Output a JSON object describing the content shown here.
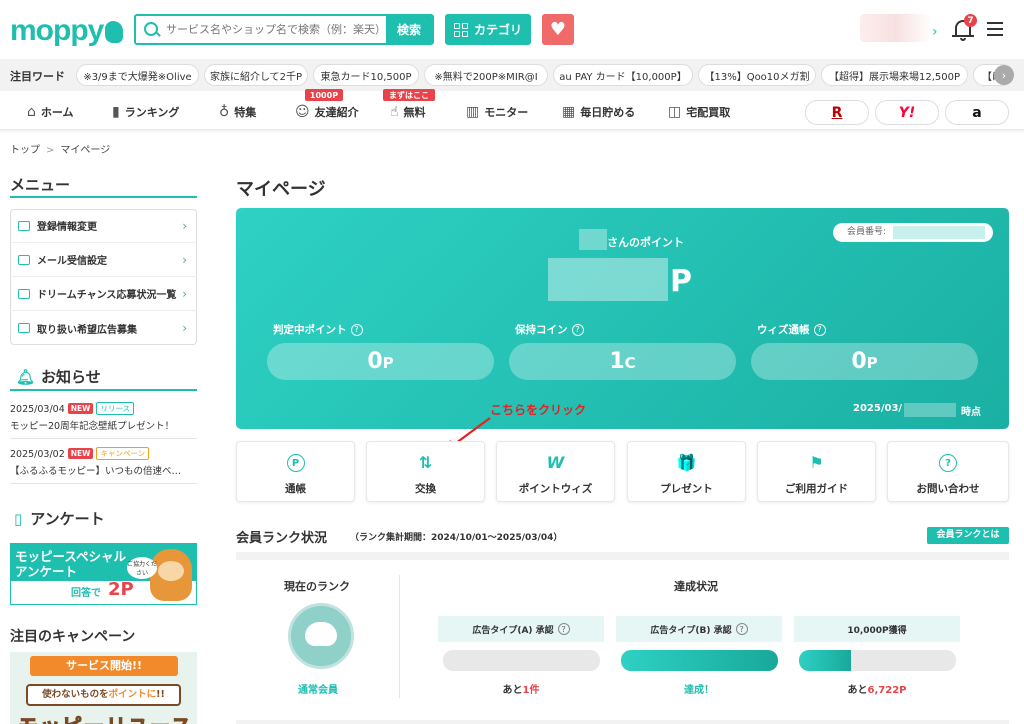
{
  "header": {
    "logo": "moppy",
    "search_placeholder": "サービス名やショップ名で検索（例：楽天）",
    "search_button": "検索",
    "category_button": "カテゴリ",
    "notification_count": "7"
  },
  "keywords": {
    "label": "注目ワード",
    "items": [
      "※3/9まで大爆発※Olive",
      "家族に紹介して2千P",
      "東急カード10,500P",
      "※無料で200P※MIR@I",
      "au PAY カード【10,000P】",
      "【13%】Qoo10メガ割",
      "【超得】展示場来場12,500P",
      "【はじめ"
    ]
  },
  "nav": {
    "items": [
      "ホーム",
      "ランキング",
      "特集",
      "友達紹介",
      "無料",
      "モニター",
      "毎日貯める",
      "宅配買取"
    ],
    "badge_friend": "1000P",
    "badge_free": "まずはここ",
    "partner_rakuten": "R",
    "partner_yahoo": "Y!",
    "partner_amazon": "a"
  },
  "breadcrumb": {
    "home": "トップ",
    "current": "マイページ"
  },
  "sidebar": {
    "menu_title": "メニュー",
    "menu": [
      "登録情報変更",
      "メール受信設定",
      "ドリームチャンス応募状況一覧",
      "取り扱い希望広告募集"
    ],
    "news_title": "お知らせ",
    "news": [
      {
        "date": "2025/03/04",
        "new": "NEW",
        "tag": "リリース",
        "title": "モッピー20周年記念壁紙プレゼント！"
      },
      {
        "date": "2025/03/02",
        "new": "NEW",
        "tag": "キャンペーン",
        "title": "【ふるふるモッピー】いつもの倍速ベ…"
      }
    ],
    "survey_title": "アンケート",
    "survey_banner_line1": "モッピースペシャル",
    "survey_banner_line2": "アンケート",
    "survey_bubble": "ご協力ください",
    "survey_answer": "回答で",
    "survey_points": "2P",
    "campaign_title": "注目のキャンペーン",
    "campaign_ribbon": "サービス開始!!",
    "campaign_line_a": "使わないものを",
    "campaign_line_b": "ポイントに",
    "campaign_line_c": "!!",
    "campaign_big": "モッピーリユース"
  },
  "main": {
    "title": "マイページ",
    "points_label": "さんのポイント",
    "points_unit": "P",
    "member_no_label": "会員番号:",
    "stats": [
      {
        "label": "判定中ポイント",
        "value": "0",
        "unit": "P"
      },
      {
        "label": "保持コイン",
        "value": "1",
        "unit": "C"
      },
      {
        "label": "ウィズ通帳",
        "value": "0",
        "unit": "P"
      }
    ],
    "as_of_prefix": "2025/03/",
    "as_of_suffix": "時点",
    "annotation": "こちらをクリック",
    "tiles": [
      {
        "icon": "P",
        "label": "通帳"
      },
      {
        "icon": "⇅",
        "label": "交換"
      },
      {
        "icon": "W",
        "label": "ポイントウィズ"
      },
      {
        "icon": "🎁",
        "label": "プレゼント"
      },
      {
        "icon": "⚑",
        "label": "ご利用ガイド"
      },
      {
        "icon": "?",
        "label": "お問い合わせ"
      }
    ]
  },
  "rank": {
    "title": "会員ランク状況",
    "period": "（ランク集計期間：2024/10/01〜2025/03/04）",
    "about_button": "会員ランクとは",
    "current_label": "現在のランク",
    "current_rank": "通常会員",
    "achievement_label": "達成状況",
    "columns": [
      {
        "label": "広告タイプ(A) 承認",
        "progress": 0,
        "result_prefix": "あと",
        "result_value": "1件"
      },
      {
        "label": "広告タイプ(B) 承認",
        "progress": 1.0,
        "result_prefix": "",
        "result_value": "達成！"
      },
      {
        "label": "10,000P獲得",
        "progress": 0.33,
        "result_prefix": "あと",
        "result_value": "6,722P"
      }
    ]
  }
}
